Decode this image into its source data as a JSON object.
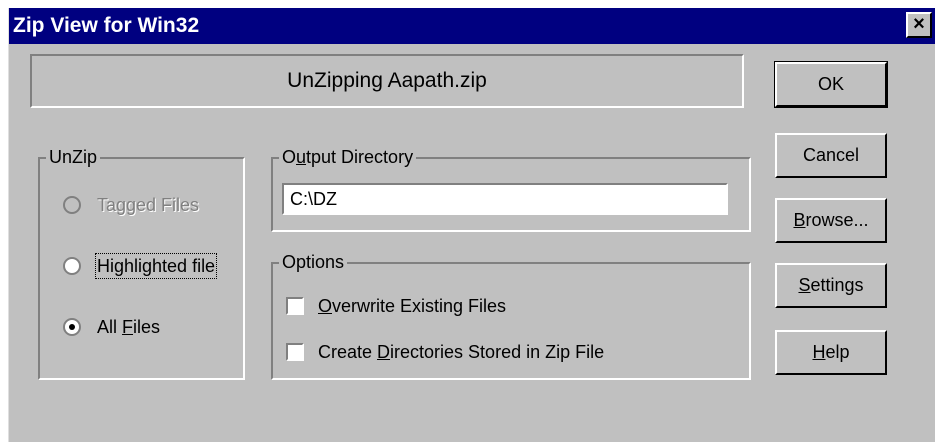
{
  "window": {
    "title": "Zip View for Win32",
    "close_glyph": "×"
  },
  "banner": {
    "text": "UnZipping Aapath.zip"
  },
  "buttons": [
    {
      "id": "ok",
      "label": "OK"
    },
    {
      "id": "cancel",
      "label": "Cancel"
    },
    {
      "id": "browse",
      "label": "Browse...",
      "mnemonic_index": 0
    },
    {
      "id": "settings",
      "label": "Settings",
      "mnemonic_index": 0
    },
    {
      "id": "help",
      "label": "Help",
      "mnemonic_index": 0
    }
  ],
  "unzip_group": {
    "legend": "UnZip",
    "options": [
      {
        "label": "Tagged Files",
        "checked": false,
        "disabled": true
      },
      {
        "label": "Highlighted file",
        "checked": false,
        "disabled": false,
        "focused": true
      },
      {
        "label": "All Files",
        "checked": true,
        "disabled": false,
        "mnemonic_char": "F"
      }
    ]
  },
  "output_group": {
    "legend": "Output Directory",
    "legend_mnemonic": "u",
    "value": "C:\\DZ"
  },
  "options_group": {
    "legend": "Options",
    "items": [
      {
        "label": "Overwrite Existing Files",
        "checked": false,
        "mnemonic_char": "O"
      },
      {
        "label": "Create Directories Stored in Zip File",
        "checked": false,
        "mnemonic_char": "D"
      }
    ]
  },
  "colors": {
    "titlebar": "#000080",
    "face": "#c0c0c0"
  }
}
